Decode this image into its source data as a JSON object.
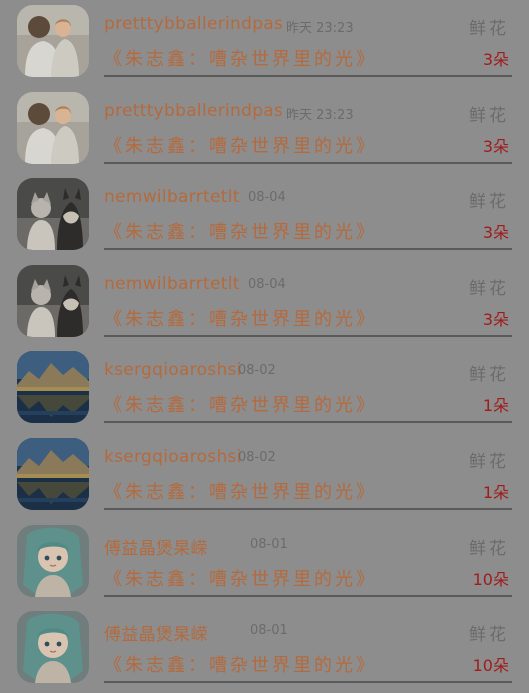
{
  "list": {
    "items": [
      {
        "name": "pretttybballerindpas",
        "time": "昨天 23:23",
        "message": "《朱志鑫：嘈杂世界里的光》",
        "gift_label": "鲜花",
        "count": "3朵",
        "avatar_icon": "mother-child-avatar-icon"
      },
      {
        "name": "pretttybballerindpas",
        "time": "昨天 23:23",
        "message": "《朱志鑫：嘈杂世界里的光》",
        "gift_label": "鲜花",
        "count": "3朵",
        "avatar_icon": "mother-child-avatar-icon"
      },
      {
        "name": "nemwilbarrtetlt",
        "time": "08-04",
        "message": "《朱志鑫：嘈杂世界里的光》",
        "gift_label": "鲜花",
        "count": "3朵",
        "avatar_icon": "child-with-dog-avatar-icon"
      },
      {
        "name": "nemwilbarrtetlt",
        "time": "08-04",
        "message": "《朱志鑫：嘈杂世界里的光》",
        "gift_label": "鲜花",
        "count": "3朵",
        "avatar_icon": "child-with-dog-avatar-icon"
      },
      {
        "name": "ksergqioaroshsi",
        "time": "08-02",
        "message": "《朱志鑫：嘈杂世界里的光》",
        "gift_label": "鲜花",
        "count": "1朵",
        "avatar_icon": "mountain-lake-avatar-icon"
      },
      {
        "name": "ksergqioaroshsi",
        "time": "08-02",
        "message": "《朱志鑫：嘈杂世界里的光》",
        "gift_label": "鲜花",
        "count": "1朵",
        "avatar_icon": "mountain-lake-avatar-icon"
      },
      {
        "name": "傅益晶煲杲嵘",
        "time": "08-01",
        "message": "《朱志鑫：嘈杂世界里的光》",
        "gift_label": "鲜花",
        "count": "10朵",
        "avatar_icon": "anime-girl-avatar-icon"
      },
      {
        "name": "傅益晶煲杲嵘",
        "time": "08-01",
        "message": "《朱志鑫：嘈杂世界里的光》",
        "gift_label": "鲜花",
        "count": "10朵",
        "avatar_icon": "anime-girl-avatar-icon"
      }
    ]
  },
  "colors": {
    "overlay_bg": "#8d8d8d",
    "name_text": "#b56a3d",
    "muted_text": "#6b6b6b",
    "count_text": "#a01c1c"
  }
}
